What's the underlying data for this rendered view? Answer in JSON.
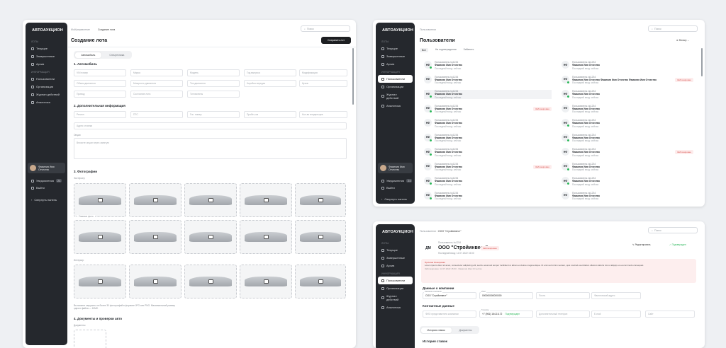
{
  "brand": "АВТОАУКЦИОН",
  "menu": {
    "sec1": "ЛОТЫ",
    "trades": "Текущие",
    "finished": "Завершенные",
    "drafts": "Архив",
    "sec2": "ИНФОРМАЦИЯ",
    "users": "Пользователи",
    "org": "Организации",
    "log": "Журнал действий",
    "analytics": "Аналитика",
    "notif": "Уведомления",
    "notif_count": "24",
    "logout": "Выйти",
    "collapse": "Свернуть панель"
  },
  "user": {
    "name": "Фамилия Имя",
    "role": "Отчество"
  },
  "w1": {
    "crumb": "Мой/управление",
    "crumb2": "Создание лота",
    "title": "Создание лота",
    "save": "Сохранить лот",
    "search": "Поиск",
    "tab1": "Автомобиль",
    "tab2": "Спецтехника",
    "s1": "1. Автомобиль",
    "s2": "2. Дополнительная информация",
    "s3": "3. Фотографии",
    "s4": "4. Документы и проверки авто",
    "f": [
      "VIN номер",
      "Марка",
      "Модель",
      "Год выпуска",
      "Модификация",
      "Объем двигателя",
      "Мощность двигателя",
      "Тип двигателя",
      "Коробка передач",
      "Кузов",
      "Привод",
      "Состояние лота",
      "Тип валюты"
    ],
    "f2": [
      "Регион",
      "ПТС",
      "Гос. номер",
      "Пробег, км",
      "Кол-во владельцев"
    ],
    "addr": "Адрес стоянки",
    "note_label": "Опции",
    "note": "Вносите опции через запятую",
    "ext": "Экстерьер",
    "main_photo": "Главное фото",
    "int": "Интерьер",
    "hint": "Вы можете загрузить не более 30 фотографий в формате JPG или PNG. Максимальный размер одного файла — 10Мб.",
    "docs": "Документы"
  },
  "w2": {
    "crumb": "Пользователи",
    "title": "Пользователи",
    "search": "Поиск",
    "tabs": [
      "Все",
      "На подтверждении",
      "Забанить"
    ],
    "filter": "Фильтр",
    "item_title": "Пользователь №1234",
    "item_name": "Фамилия Имя Отчество",
    "item_long": "Фамилия Имя Отчество Фамилия Имя Отчество Фамилия Имя Отчество",
    "item_sub": "Последний вход: сейчас",
    "tag": "Заблокирован",
    "ini": "НФ"
  },
  "w3": {
    "crumb": "Пользователи",
    "crumb2": "ООО \"Стройинвест\"",
    "search": "Поиск",
    "ini": "ДМ",
    "kind": "Пользователь №1234",
    "org": "ООО \"Стройинвест\"",
    "tag": "Заблокирован",
    "edit": "Редактировать",
    "verified": "Подтвержден",
    "last": "Последний вход: 12.07.2022 15:00",
    "alert_title": "Причина блокировки",
    "alert": "Lorem ipsum dolor sit amet, consectetur adipiscing elit, sed do eiusmod tempor incididunt ut labore et dolore magna aliqua. Ut enim ad minim veniam, quis nostrud exercitation ullamco laboris nisi ut aliquip ex ea commodo consequat.",
    "alert_meta": "Заблокирован: 12.07.2022 15:00 · Фамилия Имя Отчество",
    "company": "Данные о компании",
    "c1l": "Название компании",
    "c1": "ООО \"Стройинвест\"",
    "c2l": "ИНН",
    "c2": "000000000000000",
    "c3": "Почта",
    "c4": "Фактический адрес",
    "contacts": "Контактные данные",
    "p1": "ФИО представителя компании",
    "p2l": "Телефон",
    "p2": "+7 (961) 164-16-72",
    "p2v": "Подтвержден",
    "p3": "Дополнительный телефон",
    "p4": "E-mail",
    "p5": "Сайт",
    "t1": "История ставок",
    "t2": "Документы",
    "hist": "История ставок"
  }
}
